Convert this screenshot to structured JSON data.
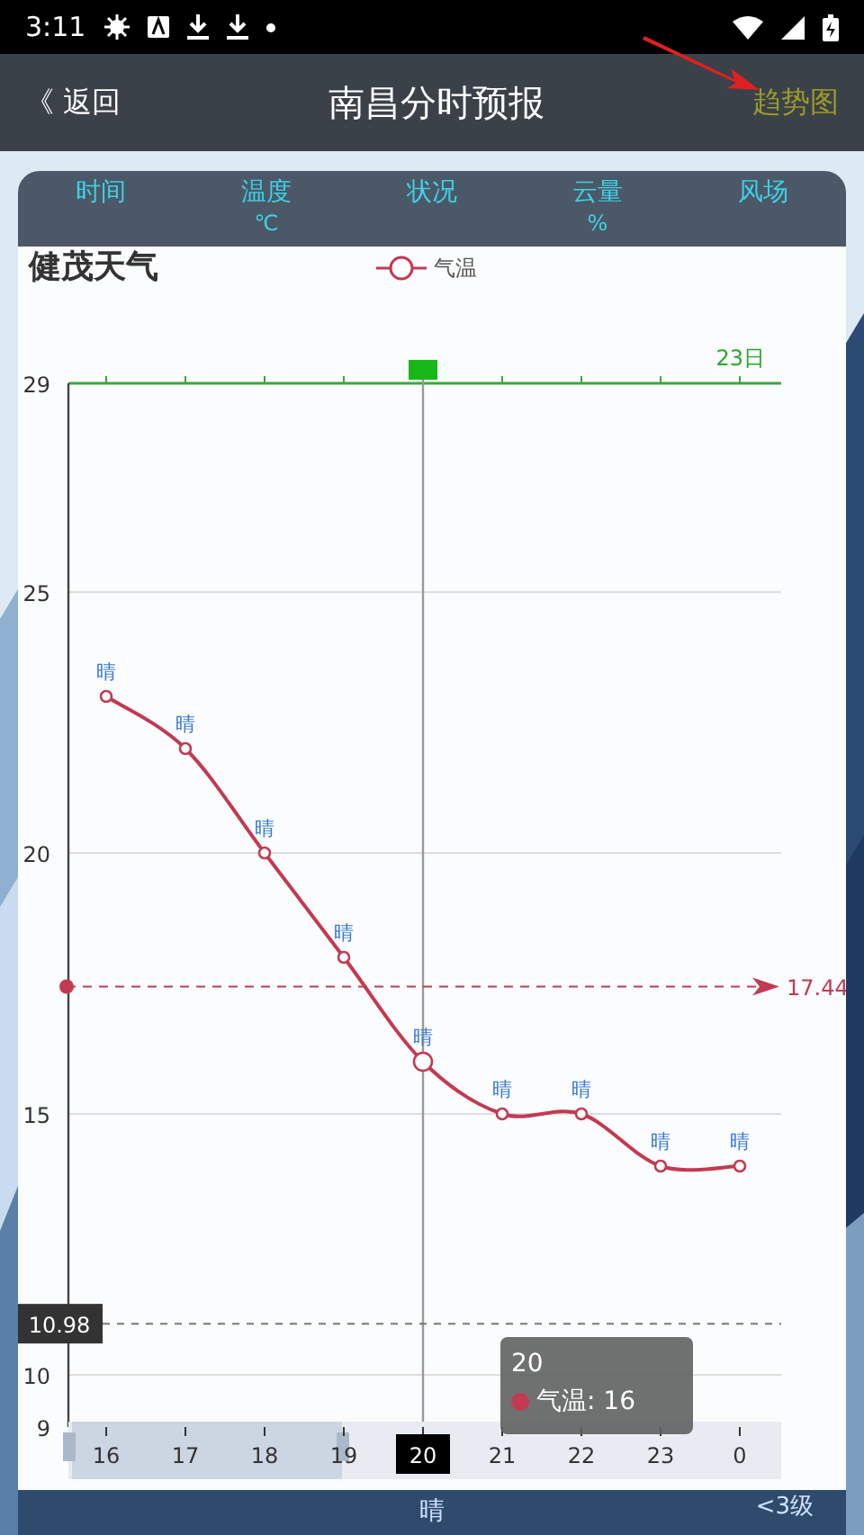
{
  "status_bar": {
    "time": "3:11"
  },
  "app_bar": {
    "back": "《 返回",
    "title": "南昌分时预报",
    "action": "趋势图"
  },
  "table_header": [
    {
      "label": "时间"
    },
    {
      "label": "温度",
      "unit": "℃"
    },
    {
      "label": "状况"
    },
    {
      "label": "云量",
      "unit": "%"
    },
    {
      "label": "风场"
    }
  ],
  "chart": {
    "cursor": "20",
    "date_marker": "23日",
    "tooltip": {
      "title": "20",
      "text": "气温: 16"
    },
    "chart_data": {
      "type": "line",
      "title": "健茂天气",
      "categories": [
        "16",
        "17",
        "18",
        "19",
        "20",
        "21",
        "22",
        "23",
        "0"
      ],
      "series": [
        {
          "name": "气温",
          "color": "#c23a52",
          "marker": "o",
          "values": [
            23,
            22,
            20,
            18,
            16,
            15,
            15,
            14,
            14
          ]
        }
      ],
      "grid": true,
      "ylim": [
        9,
        29
      ],
      "yticks": [
        9,
        10,
        15,
        20,
        25,
        29
      ],
      "value_labels": [
        "晴",
        "晴",
        "晴",
        "晴",
        "晴",
        "晴",
        "晴",
        "晴",
        "晴"
      ],
      "ref_lines": [
        {
          "axis": "x",
          "value": "20",
          "color": "#999999"
        },
        {
          "axis": "y",
          "value": 17.44,
          "label": "17.44",
          "color": "#c23a52"
        },
        {
          "axis": "y",
          "value": 10.98,
          "label": "10.98",
          "color": "#777777"
        }
      ]
    }
  },
  "bottom_row": {
    "condition": "晴",
    "wind": "<3级"
  }
}
